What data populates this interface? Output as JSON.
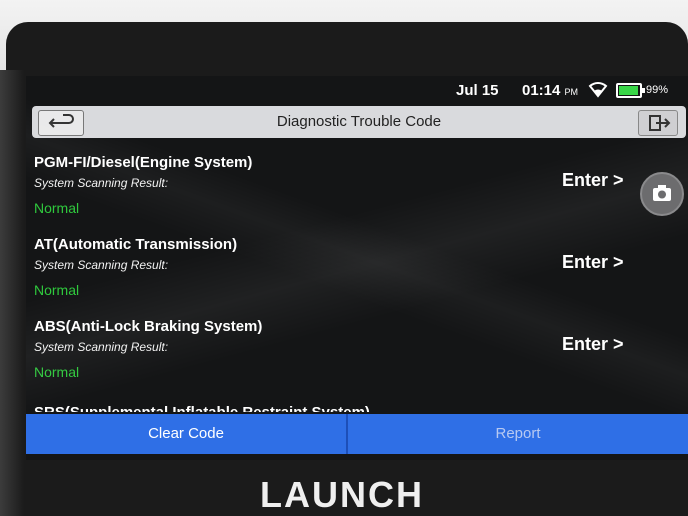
{
  "status_bar": {
    "date": "Jul 15",
    "time": "01:14",
    "ampm": "PM",
    "battery": "99%",
    "battery_level": 0.99
  },
  "header": {
    "title": "Diagnostic Trouble Code",
    "back_icon": "back-arrow-icon",
    "exit_icon": "exit-icon"
  },
  "systems": [
    {
      "name": "PGM-FI/Diesel(Engine System)",
      "subtitle": "System Scanning Result:",
      "status": "Normal",
      "action": "Enter >"
    },
    {
      "name": "AT(Automatic Transmission)",
      "subtitle": "System Scanning Result:",
      "status": "Normal",
      "action": "Enter >"
    },
    {
      "name": "ABS(Anti-Lock Braking System)",
      "subtitle": "System Scanning Result:",
      "status": "Normal",
      "action": "Enter >"
    },
    {
      "name": "SRS(Supplemental Inflatable Restraint System)"
    }
  ],
  "actions": {
    "clear_code": "Clear Code",
    "report": "Report"
  },
  "device_brand": "LAUNCH",
  "colors": {
    "accent": "#2f6fe6",
    "status_normal": "#2fc93d",
    "titlebar": "#d9dadd"
  },
  "icons": {
    "camera": "camera-icon",
    "wifi": "wifi-icon",
    "battery": "battery-icon"
  }
}
